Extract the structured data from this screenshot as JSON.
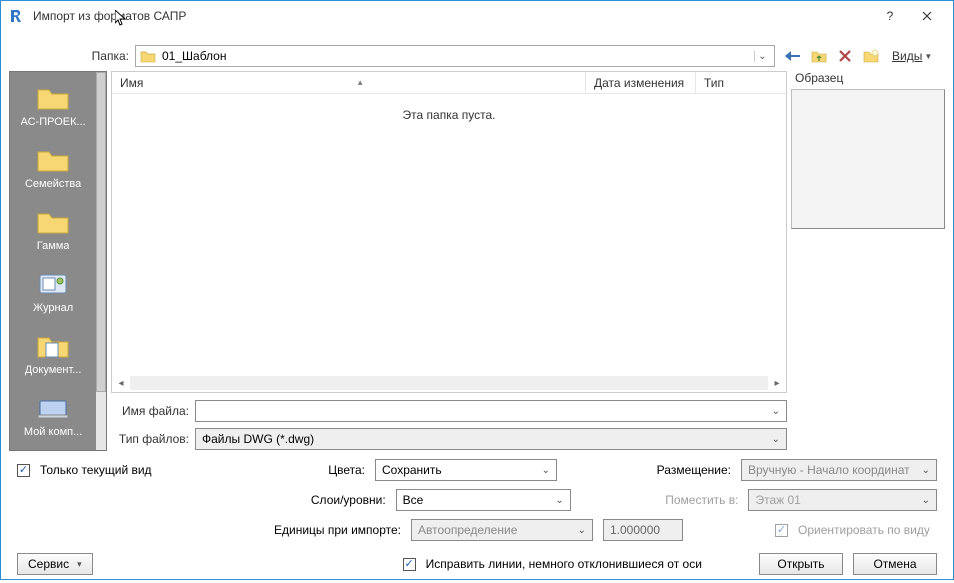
{
  "titlebar": {
    "title": "Импорт из форматов САПР"
  },
  "folder_row": {
    "label": "Папка:",
    "current": "01_Шаблон",
    "views_label": "Виды"
  },
  "places": [
    {
      "label": "АС-ПРОЕК...",
      "kind": "folder"
    },
    {
      "label": "Семейства",
      "kind": "folder"
    },
    {
      "label": "Гамма",
      "kind": "folder"
    },
    {
      "label": "Журнал",
      "kind": "journal"
    },
    {
      "label": "Документ...",
      "kind": "documents"
    },
    {
      "label": "Мой комп...",
      "kind": "pc"
    }
  ],
  "list": {
    "columns": {
      "name": "Имя",
      "date": "Дата изменения",
      "type": "Тип"
    },
    "empty_text": "Эта папка пуста."
  },
  "filefields": {
    "name_label": "Имя файла:",
    "name_value": "",
    "type_label": "Тип файлов:",
    "type_value": "Файлы DWG  (*.dwg)"
  },
  "preview": {
    "header": "Образец"
  },
  "options": {
    "current_view_only": "Только текущий вид",
    "colors_label": "Цвета:",
    "colors_value": "Сохранить",
    "layers_label": "Слои/уровни:",
    "layers_value": "Все",
    "units_label": "Единицы при импорте:",
    "units_value": "Автоопределение",
    "units_scale": "1.000000",
    "placement_label": "Размещение:",
    "placement_value": "Вручную - Начало координат",
    "place_at_label": "Поместить в:",
    "place_at_value": "Этаж 01",
    "orient_to_view": "Ориентировать по виду",
    "fix_lines": "Исправить линии, немного отклонившиеся от оси"
  },
  "buttons": {
    "service": "Сервис",
    "open": "Открыть",
    "cancel": "Отмена"
  }
}
